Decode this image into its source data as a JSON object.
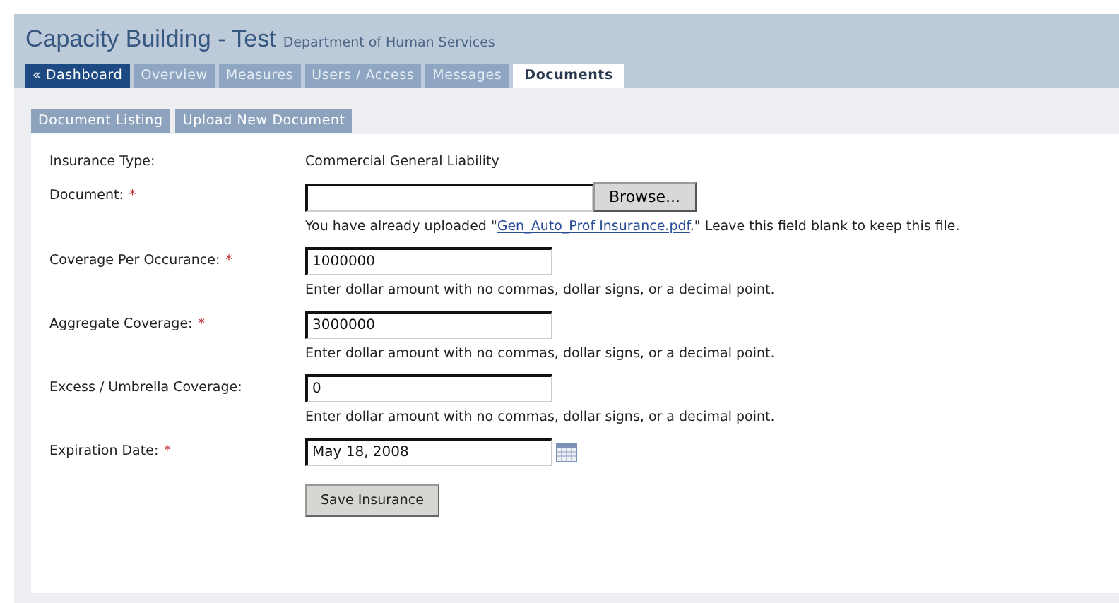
{
  "header": {
    "title": "Capacity Building - Test",
    "subtitle": "Department of Human Services"
  },
  "tabs": [
    {
      "label": "« Dashboard",
      "kind": "back",
      "selected": false
    },
    {
      "label": "Overview",
      "kind": "tab",
      "selected": false
    },
    {
      "label": "Measures",
      "kind": "tab",
      "selected": false
    },
    {
      "label": "Users / Access",
      "kind": "tab",
      "selected": false
    },
    {
      "label": "Messages",
      "kind": "tab",
      "selected": false
    },
    {
      "label": "Documents",
      "kind": "tab",
      "selected": true
    }
  ],
  "subtabs": [
    "Document Listing",
    "Upload New Document"
  ],
  "form": {
    "rows": [
      {
        "kind": "static",
        "label": "Insurance Type:",
        "value": "Commercial General Liability"
      },
      {
        "kind": "file",
        "label": "Document:",
        "required_mark": "*",
        "browse": "Browse...",
        "note": {
          "before": "You have already uploaded \"",
          "link": "Gen_Auto_Prof Insurance.pdf",
          "after": ".\" Leave this field blank to keep this file."
        }
      },
      {
        "kind": "text",
        "label": "Coverage Per Occurance:",
        "required_mark": "*",
        "value": "1000000",
        "hint": "Enter dollar amount with no commas, dollar signs, or a decimal point."
      },
      {
        "kind": "text",
        "label": "Aggregate Coverage:",
        "required_mark": "*",
        "value": "3000000",
        "hint": "Enter dollar amount with no commas, dollar signs, or a decimal point."
      },
      {
        "kind": "text",
        "label": "Excess / Umbrella Coverage:",
        "value": "0",
        "hint": "Enter dollar amount with no commas, dollar signs, or a decimal point."
      },
      {
        "kind": "date",
        "label": "Expiration Date:",
        "required_mark": "*",
        "value": "May 18, 2008"
      }
    ],
    "submit": "Save Insurance"
  }
}
